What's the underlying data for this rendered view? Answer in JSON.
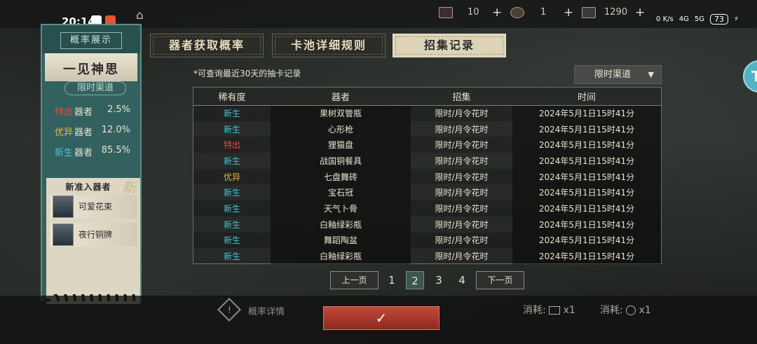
{
  "status_bar": {
    "time": "20:14",
    "sys_speed": "0\nK/s",
    "net1": "4G",
    "net2": "5G",
    "battery": "73"
  },
  "resources": [
    {
      "icon": "letter-ticket-icon",
      "count": "10"
    },
    {
      "icon": "coin-icon",
      "count": "1"
    },
    {
      "icon": "scroll-icon",
      "count": "1290"
    }
  ],
  "left_panel": {
    "header": "概率展示",
    "title": "一见神思",
    "channel": "限时渠道",
    "rarities": [
      {
        "rarity": "特出",
        "noun": "器者",
        "percent": "2.5%",
        "color": "#e84a3c"
      },
      {
        "rarity": "优异",
        "noun": "器者",
        "percent": "12.0%",
        "color": "#e8b63e"
      },
      {
        "rarity": "新生",
        "noun": "器者",
        "percent": "85.5%",
        "color": "#49c2cf"
      }
    ],
    "new_section": {
      "title": "新准入器者",
      "badge": "新",
      "items": [
        {
          "name": "可爱花束"
        },
        {
          "name": "夜行铜牌"
        }
      ]
    }
  },
  "tabs": [
    {
      "label": "器者获取概率"
    },
    {
      "label": "卡池详细规则"
    },
    {
      "label": "招集记录"
    }
  ],
  "main": {
    "note": "*可查询最近30天的抽卡记录",
    "dropdown": "限时渠道",
    "headers": [
      "稀有度",
      "器者",
      "招集",
      "时间"
    ],
    "rows": [
      {
        "rarity": "新生",
        "item": "果树双管瓶",
        "channel": "限时/月令花时",
        "time": "2024年5月1日15时41分"
      },
      {
        "rarity": "新生",
        "item": "心形枪",
        "channel": "限时/月令花时",
        "time": "2024年5月1日15时41分"
      },
      {
        "rarity": "特出",
        "item": "狸猫盘",
        "channel": "限时/月令花时",
        "time": "2024年5月1日15时41分"
      },
      {
        "rarity": "新生",
        "item": "战国铜餐具",
        "channel": "限时/月令花时",
        "time": "2024年5月1日15时41分"
      },
      {
        "rarity": "优异",
        "item": "七盘舞砖",
        "channel": "限时/月令花时",
        "time": "2024年5月1日15时41分"
      },
      {
        "rarity": "新生",
        "item": "宝石冠",
        "channel": "限时/月令花时",
        "time": "2024年5月1日15时41分"
      },
      {
        "rarity": "新生",
        "item": "天气卜骨",
        "channel": "限时/月令花时",
        "time": "2024年5月1日15时41分"
      },
      {
        "rarity": "新生",
        "item": "白釉绿彩瓶",
        "channel": "限时/月令花时",
        "time": "2024年5月1日15时41分"
      },
      {
        "rarity": "新生",
        "item": "舞蹈陶盆",
        "channel": "限时/月令花时",
        "time": "2024年5月1日15时41分"
      },
      {
        "rarity": "新生",
        "item": "白釉绿彩瓶",
        "channel": "限时/月令花时",
        "time": "2024年5月1日15时41分"
      }
    ]
  },
  "pagination": {
    "prev": "上一页",
    "next": "下一页",
    "pages": [
      "1",
      "2",
      "3",
      "4"
    ],
    "current": "2"
  },
  "bottom": {
    "prob_details": "概率详情",
    "cost_label": "消耗:",
    "cost1": "x1",
    "cost2": "x1",
    "confirm": "✓"
  },
  "side_button": "T"
}
